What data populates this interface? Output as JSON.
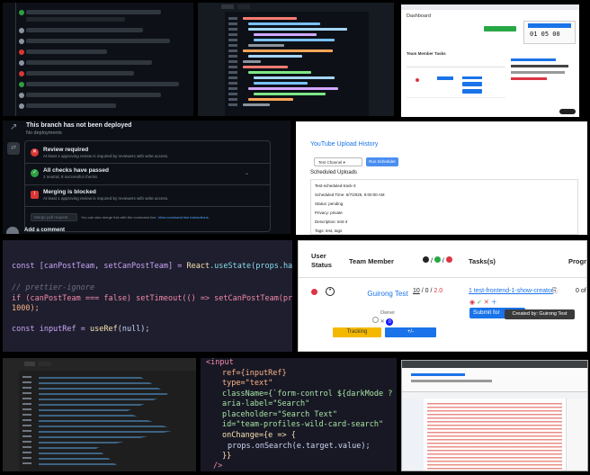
{
  "tile4": {
    "deploy_title": "This branch has not been deployed",
    "deploy_sub": "No deployments",
    "review_title": "Review required",
    "review_sub": "At least 1 approving review is required by reviewers with write access.",
    "checks_title": "All checks have passed",
    "checks_sub": "2 neutral, 8 successful checks",
    "merge_title": "Merging is blocked",
    "merge_sub": "At least 1 approving review is required by reviewers with write access.",
    "merge_button": "Merge pull request",
    "merge_note": "You can also merge this with the command line.",
    "merge_link": "View command line instructions.",
    "comment_heading": "Add a comment"
  },
  "tile5": {
    "title": "YouTube Upload History",
    "select_value": "Test Channel",
    "button": "Run Scheduler",
    "section": "Scheduled Uploads",
    "rows": [
      "Test-scheduled-track-3",
      "Scheduled Time: 6/7/2025, 9:00:00 AM",
      "Status: pending",
      "Privacy: private",
      "Description: test-3",
      "Tags: test, tags"
    ]
  },
  "tile6": {
    "line1_a": "const [canPostTeam, setCanPostTeam] = ",
    "line1_b": "React",
    "line1_c": ".useState(props.hasPermissio",
    "line2": "// prettier-ignore",
    "line3_a": "if (canPostTeam === false) setTimeout(() => setCanPostTeam(props.hasPerm",
    "line4": "1000);",
    "line5_a": "const inputRef = ",
    "line5_b": "useRef",
    "line5_c": "(null);"
  },
  "tile7": {
    "headers": {
      "status": "User Status",
      "member": "Team Member",
      "tasks": "Tasks(s)",
      "progress": "Progr"
    },
    "member_name": "Guirong Test",
    "member_role": "Owner",
    "counts": {
      "a": "10",
      "b": "0",
      "c": "2.0"
    },
    "task_link": "1 test-frontend-1-show-creator",
    "submit": "Submit for",
    "tooltip": "Created by: Guirong Test",
    "progress_value": "0 of",
    "tracking_button": "Tracking",
    "plusminus_button": "+/-",
    "badge_count": "0"
  },
  "tile9": {
    "lines": [
      "<input",
      "ref={inputRef}",
      "type=\"text\"",
      "className={`form-control ${darkMode ? 'bg-",
      "aria-label=\"Search\"",
      "placeholder=\"Search Text\"",
      "id=\"team-profiles-wild-card-search\"",
      "onChange={e =>  {",
      "props.onSearch(e.target.value);",
      "}}",
      "/>"
    ]
  },
  "tile3": {
    "page_title": "Dashboard",
    "team_header": "Team Member Tasks",
    "timer": "01 05 00"
  },
  "colors": {
    "github_bg": "#0d1117",
    "success": "#2ea043",
    "danger": "#da3633",
    "link_blue": "#1a73e8",
    "tracking_yellow": "#f5b800"
  }
}
